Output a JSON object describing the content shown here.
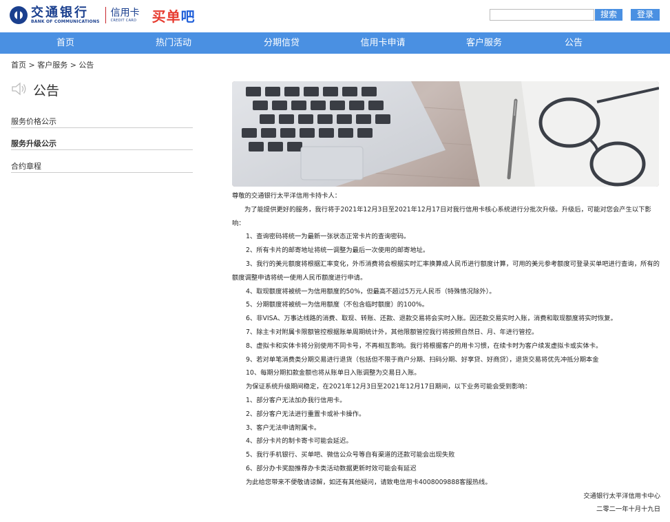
{
  "header": {
    "logo_cn": "交通银行",
    "logo_en": "BANK OF COMMUNICATIONS",
    "card_cn": "信用卡",
    "card_en": "CREDIT CARD",
    "brand_prefix": "买",
    "brand_mid": "单",
    "brand_suffix": "吧",
    "search_placeholder": "",
    "search_button": "搜索",
    "login_button": "登录"
  },
  "nav": {
    "items": [
      "首页",
      "热门活动",
      "分期信贷",
      "信用卡申请",
      "客户服务",
      "公告"
    ]
  },
  "breadcrumb": "首页 > 客户服务 > 公告",
  "sidebar": {
    "title": "公告",
    "icon": "speaker-icon",
    "links": [
      "服务价格公示",
      "服务升级公示",
      "合约章程"
    ]
  },
  "notice": {
    "greeting": "尊敬的交通银行太平洋信用卡持卡人：",
    "intro": "为了能提供更好的服务，我行将于2021年12月3日至2021年12月17日对我行信用卡核心系统进行分批次升级。升级后，可能对您会产生以下影响：",
    "impacts": [
      "1、查询密码将统一为最新一张状态正常卡片的查询密码。",
      "2、所有卡片的邮寄地址将统一调整为最后一次使用的邮寄地址。",
      "3、我行的美元额度将根据汇率变化，外币消费将会根据实时汇率换算成人民币进行额度计算，可用的美元参考额度可登录买单吧进行查询，所有的额度调整申请将统一使用人民币额度进行申请。",
      "4、取现额度将被统一为信用额度的50%，但最高不超过5万元人民币（特殊情况除外）。",
      "5、分期额度将被统一为信用额度（不包含临时额度）的100%。",
      "6、非VISA、万事达线路的消费、取现、转账、还款、退款交易将会实时入账。因还款交易实时入账，消费和取现额度将实时恢复。",
      "7、除主卡对附属卡限额管控根据账单周期统计外，其他限额管控我行将按照自然日、月、年进行管控。",
      "8、虚拟卡和实体卡将分别使用不同卡号，不再相互影响。我行将根据客户的用卡习惯，在续卡时为客户续发虚拟卡或实体卡。",
      "9、若对单笔消费类分期交易进行退货（包括但不限于商户分期、扫码分期、好享贷、好商贷），退货交易将优先冲抵分期本金",
      "10、每期分期扣款金额也将从账单日入账调整为交易日入账。"
    ],
    "period_intro": "为保证系统升级期间稳定，在2021年12月3日至2021年12月17日期间，以下业务可能会受到影响：",
    "affected": [
      "1、部分客户无法加办我行信用卡。",
      "2、部分客户无法进行重置卡或补卡操作。",
      "3、客户无法申请附属卡。",
      "4、部分卡片的制卡寄卡可能会延迟。",
      "5、我行手机银行、买单吧、微信公众号等自有渠道的还款可能会出现失败",
      "6、部分办卡奖励推荐办卡类活动数据更新时效可能会有延迟"
    ],
    "closing": "为此给您带来不便敬请谅解，如还有其他疑问，请致电信用卡4008009888客服热线。",
    "signature": "交通银行太平洋信用卡中心",
    "date": "二零二一年十月十九日"
  }
}
